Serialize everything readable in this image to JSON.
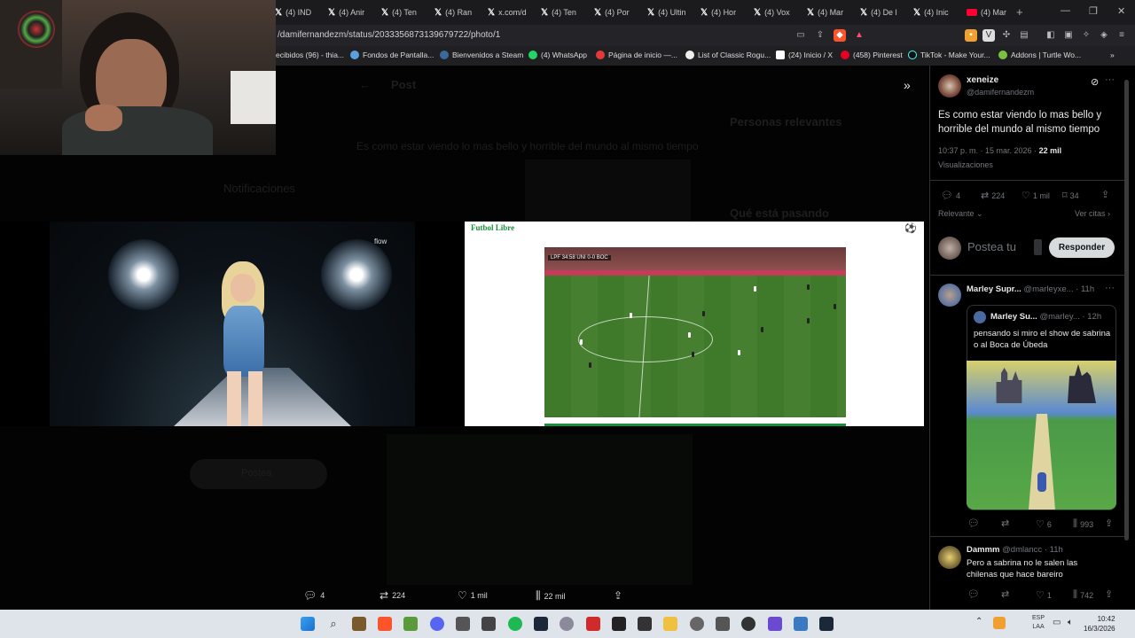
{
  "browser": {
    "tabs": [
      {
        "label": "(4) IND"
      },
      {
        "label": "(4) Anir"
      },
      {
        "label": "(4) Ten"
      },
      {
        "label": "(4) Ran"
      },
      {
        "label": "x.com/d"
      },
      {
        "label": "(4) Ten"
      },
      {
        "label": "(4) Por"
      },
      {
        "label": "(4) Ultin"
      },
      {
        "label": "(4) Hor"
      },
      {
        "label": "(4) Vox"
      },
      {
        "label": "(4) Mar"
      },
      {
        "label": "(4) De l"
      },
      {
        "label": "(4) Inic"
      },
      {
        "label": "(4) Mar"
      }
    ],
    "new_tab": "+",
    "url": "/damifernandezm/status/2033356873139679722/photo/1",
    "bookmarks": [
      {
        "label": "ecibidos (96) - thia..."
      },
      {
        "label": "Fondos de Pantalla..."
      },
      {
        "label": "Bienvenidos a Steam"
      },
      {
        "label": "(4) WhatsApp"
      },
      {
        "label": "Página de inicio —..."
      },
      {
        "label": "List of Classic Rogu..."
      },
      {
        "label": "(24) Inicio / X"
      },
      {
        "label": "(458) Pinterest"
      },
      {
        "label": "TikTok - Make Your..."
      },
      {
        "label": "Addons | Turtle Wo..."
      }
    ]
  },
  "background_page": {
    "post_header": "Post",
    "tweet_text": "Es como estar viendo lo mas bello y horrible del mundo al mismo tiempo",
    "nav_notifications": "Notificaciones",
    "nav_posts": "Postea",
    "sidebar_relevant": "Personas relevantes",
    "sidebar_happening": "Qué está pasando"
  },
  "concert": {
    "logo": "flow"
  },
  "futbol": {
    "title": "Futbol Libre",
    "scorebug": "LPF 34:58  UNI 0-0 BOC"
  },
  "post": {
    "display_name": "xeneize",
    "handle": "@damifernandezm",
    "text": "Es como estar viendo lo mas bello y horrible del mundo al mismo tiempo",
    "time": "10:37 p. m. · 15 mar. 2026 · ",
    "views_count": "22 mil",
    "views_label": "Visualizaciones",
    "stats": {
      "replies": "4",
      "reposts": "224",
      "likes": "1 mil",
      "bookmarks": "34"
    },
    "sort_label": "Relevante",
    "quotes_label": "Ver citas",
    "reply_placeholder": "Postea tu",
    "reply_button": "Responder"
  },
  "replies": [
    {
      "name": "Marley Supr...",
      "handle": "@marleyxe...",
      "time": "· 11h",
      "quoted": {
        "name": "Marley Su...",
        "handle": "@marley...",
        "time": "· 12h",
        "text": "pensando si miro el show de sabrina o al Boca de Úbeda"
      },
      "stats": {
        "likes": "6",
        "views": "993"
      }
    },
    {
      "name": "Dammm",
      "handle": "@dmlancc",
      "time": "· 11h",
      "text": "Pero a sabrina no le salen las chilenas que hace bareiro",
      "stats": {
        "likes": "1",
        "views": "742"
      }
    }
  ],
  "bottom_stats": {
    "replies": "4",
    "reposts": "224",
    "likes": "1 mil",
    "views": "22 mil"
  },
  "taskbar": {
    "lang_top": "ESP",
    "lang_bottom": "LAA",
    "time": "10:42",
    "date": "16/3/2026"
  }
}
